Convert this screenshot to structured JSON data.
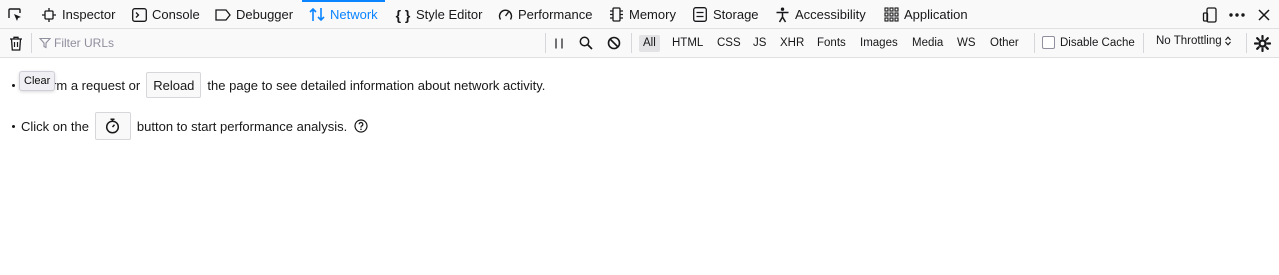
{
  "tabs": [
    {
      "label": "Inspector",
      "icon": "inspector-icon"
    },
    {
      "label": "Console",
      "icon": "console-icon"
    },
    {
      "label": "Debugger",
      "icon": "debugger-icon"
    },
    {
      "label": "Network",
      "icon": "network-icon",
      "selected": true
    },
    {
      "label": "Style Editor",
      "icon": "style-editor-icon"
    },
    {
      "label": "Performance",
      "icon": "performance-icon"
    },
    {
      "label": "Memory",
      "icon": "memory-icon"
    },
    {
      "label": "Storage",
      "icon": "storage-icon"
    },
    {
      "label": "Accessibility",
      "icon": "accessibility-icon"
    },
    {
      "label": "Application",
      "icon": "application-icon"
    }
  ],
  "toolbar": {
    "filter_placeholder": "Filter URLs",
    "types": [
      "All",
      "HTML",
      "CSS",
      "JS",
      "XHR",
      "Fonts",
      "Images",
      "Media",
      "WS",
      "Other"
    ],
    "active_type": "All",
    "disable_cache_label": "Disable Cache",
    "disable_cache_checked": false,
    "throttling_label": "No Throttling"
  },
  "tooltip": {
    "text": "Clear"
  },
  "empty_state": {
    "line1_before": "Perform a request or",
    "reload_label": "Reload",
    "line1_after": "the page to see detailed information about network activity.",
    "line2_before": "Click on the",
    "line2_after": "button to start performance analysis."
  },
  "colors": {
    "accent": "#0a84ff",
    "toolbar_bg": "#f9f9fa"
  }
}
